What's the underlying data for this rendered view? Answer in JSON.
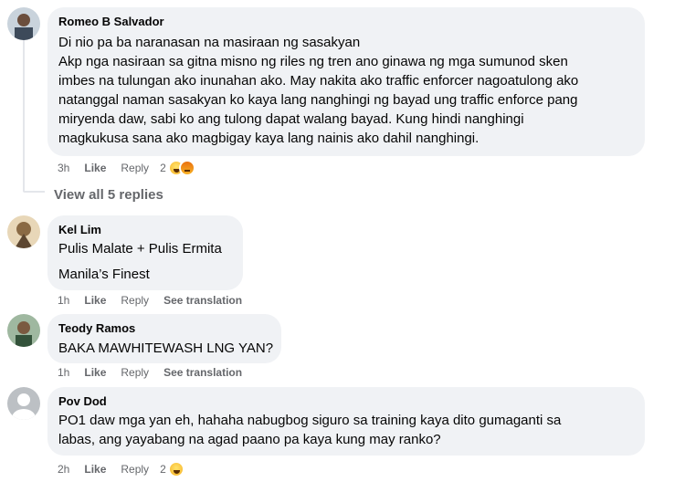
{
  "comments": [
    {
      "author": "Romeo B Salvador",
      "lines": [
        "Di nio pa ba naranasan na masiraan ng sasakyan",
        "Akp nga nasiraan sa gitna misno ng riles ng tren ano ginawa ng mga sumunod sken",
        "imbes na tulungan ako inunahan ako. May nakita ako traffic enforcer nagoatulong ako",
        "natanggal naman sasakyan ko kaya lang nanghingi ng bayad ung traffic enforce pang",
        "miryenda daw, sabi ko ang tulong dapat walang bayad. Kung hindi nanghingi",
        "magkukusa sana ako magbigay kaya lang nainis ako dahil nanghingi."
      ],
      "time": "3h",
      "like": "Like",
      "reply": "Reply",
      "reactions": "2",
      "reaction_icons": [
        "haha-icon",
        "angry-icon"
      ]
    },
    {
      "author": "Kel Lim",
      "lines": [
        "Pulis Malate + Pulis Ermita",
        "Manila’s Finest"
      ],
      "time": "1h",
      "like": "Like",
      "reply": "Reply",
      "translate": "See translation"
    },
    {
      "author": "Teody Ramos",
      "lines": [
        "BAKA MAWHITEWASH LNG YAN?"
      ],
      "time": "1h",
      "like": "Like",
      "reply": "Reply",
      "translate": "See translation"
    },
    {
      "author": "Pov Dod",
      "lines": [
        "PO1 daw mga yan eh, hahaha nabugbog siguro sa training kaya dito gumaganti sa",
        "labas, ang yayabang na agad paano pa kaya kung may ranko?"
      ],
      "time": "2h",
      "like": "Like",
      "reply": "Reply",
      "reactions": "2",
      "reaction_icons": [
        "haha-icon"
      ]
    }
  ],
  "view_replies": "View all 5 replies"
}
